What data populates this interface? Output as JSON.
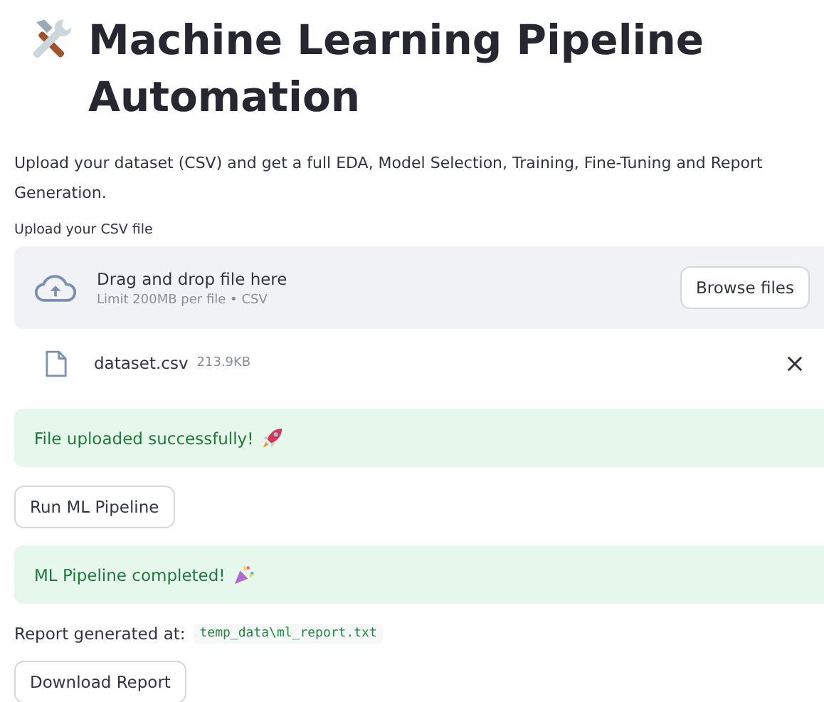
{
  "title": "Machine Learning Pipeline Automation",
  "description": "Upload your dataset (CSV) and get a full EDA, Model Selection, Training, Fine-Tuning and Report Generation.",
  "uploader": {
    "label": "Upload your CSV file",
    "prompt": "Drag and drop file here",
    "limit": "Limit 200MB per file • CSV",
    "button": "Browse files"
  },
  "file": {
    "name": "dataset.csv",
    "size": "213.9KB"
  },
  "alerts_1": {
    "text": "File uploaded successfully!"
  },
  "run_button": "Run ML Pipeline",
  "alerts_2": {
    "text": "ML Pipeline completed!"
  },
  "report": {
    "label": "Report generated at:",
    "path": "temp_data\\ml_report.txt"
  },
  "download_button": "Download Report"
}
